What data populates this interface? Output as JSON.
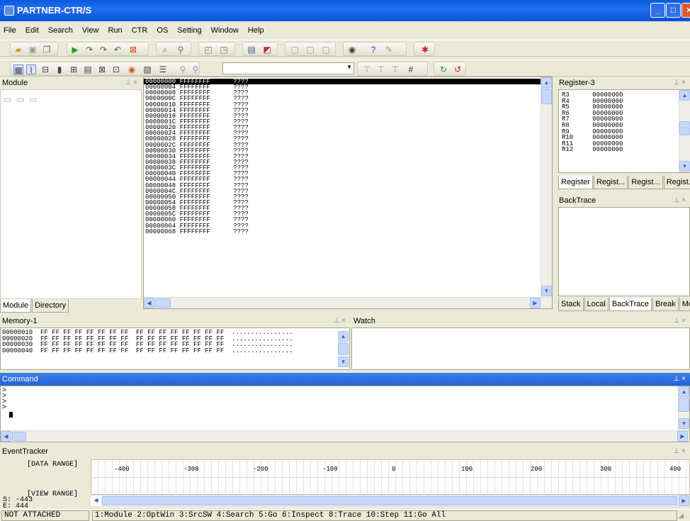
{
  "window": {
    "title": "PARTNER-CTR/S"
  },
  "menu": [
    "File",
    "Edit",
    "Search",
    "View",
    "Run",
    "CTR",
    "OS",
    "Setting",
    "Window",
    "Help"
  ],
  "toolbar1_icons": [
    "open-icon",
    "save-icon",
    "copy-icon",
    "run-icon",
    "step-into-icon",
    "step-over-icon",
    "step-out-icon",
    "stop-icon",
    "find-icon",
    "watch-icon",
    "window-a-icon",
    "window-b-icon",
    "trace-icon",
    "break-icon",
    "view-a-icon",
    "view-b-icon",
    "view-c-icon",
    "target-icon",
    "help-icon",
    "about-icon",
    "bug-icon"
  ],
  "module_panel": {
    "title": "Module",
    "tabs": [
      "Module",
      "Directory"
    ],
    "active_tab": 0
  },
  "disasm": {
    "lines": [
      "00000000 FFFFFFFF      ????",
      "00000004 FFFFFFFF      ????",
      "00000008 FFFFFFFF      ????",
      "0000000C FFFFFFFF      ????",
      "00000010 FFFFFFFF      ????",
      "00000014 FFFFFFFF      ????",
      "00000018 FFFFFFFF      ????",
      "0000001C FFFFFFFF      ????",
      "00000020 FFFFFFFF      ????",
      "00000024 FFFFFFFF      ????",
      "00000028 FFFFFFFF      ????",
      "0000002C FFFFFFFF      ????",
      "00000030 FFFFFFFF      ????",
      "00000034 FFFFFFFF      ????",
      "00000038 FFFFFFFF      ????",
      "0000003C FFFFFFFF      ????",
      "00000040 FFFFFFFF      ????",
      "00000044 FFFFFFFF      ????",
      "00000048 FFFFFFFF      ????",
      "0000004C FFFFFFFF      ????",
      "00000050 FFFFFFFF      ????",
      "00000054 FFFFFFFF      ????",
      "00000058 FFFFFFFF      ????",
      "0000005C FFFFFFFF      ????",
      "00000060 FFFFFFFF      ????",
      "00000064 FFFFFFFF      ????",
      "00000068 FFFFFFFF      ????"
    ]
  },
  "register_panel": {
    "title": "Register-3",
    "lines": [
      "R3      00000000",
      "R4      00000000",
      "R5      00000000",
      "R6      00000000",
      "R7      00000000",
      "R8      00000000",
      "R9      00000000",
      "R10     00000000",
      "R11     00000000",
      "R12     00000000"
    ],
    "tabs": [
      "Register",
      "Regist...",
      "Regist...",
      "Regist..."
    ]
  },
  "backtrace_panel": {
    "title": "BackTrace",
    "tabs": [
      "Stack",
      "Local",
      "BackTrace",
      "Break",
      "Memo"
    ],
    "active_tab": 2
  },
  "memory_panel": {
    "title": "Memory-1",
    "lines": [
      "00000010  FF FF FF FF FF FF FF FF  FF FF FF FF FF FF FF FF  ................",
      "00000020  FF FF FF FF FF FF FF FF  FF FF FF FF FF FF FF FF  ................",
      "00000030  FF FF FF FF FF FF FF FF  FF FF FF FF FF FF FF FF  ................",
      "00000040  FF FF FF FF FF FF FF FF  FF FF FF FF FF FF FF FF  ................"
    ]
  },
  "watch_panel": {
    "title": "Watch"
  },
  "command_panel": {
    "title": "Command",
    "prompts": [
      ">",
      ">",
      ">",
      ">"
    ]
  },
  "event_tracker": {
    "title": "EventTracker",
    "data_range_label": "[DATA RANGE]",
    "view_range_label": "[VIEW RANGE]",
    "s_value": "S: -443",
    "e_value": "E: 444",
    "axis_ticks": [
      "-400",
      "-300",
      "-200",
      "-100",
      "0",
      "100",
      "200",
      "300",
      "400"
    ]
  },
  "status": {
    "state": "NOT ATTACHED",
    "keys": "1:Module 2:OptWin 3:SrcSW 4:Search 5:Go 6:Inspect 8:Trace 10:Step 11:Go All"
  }
}
